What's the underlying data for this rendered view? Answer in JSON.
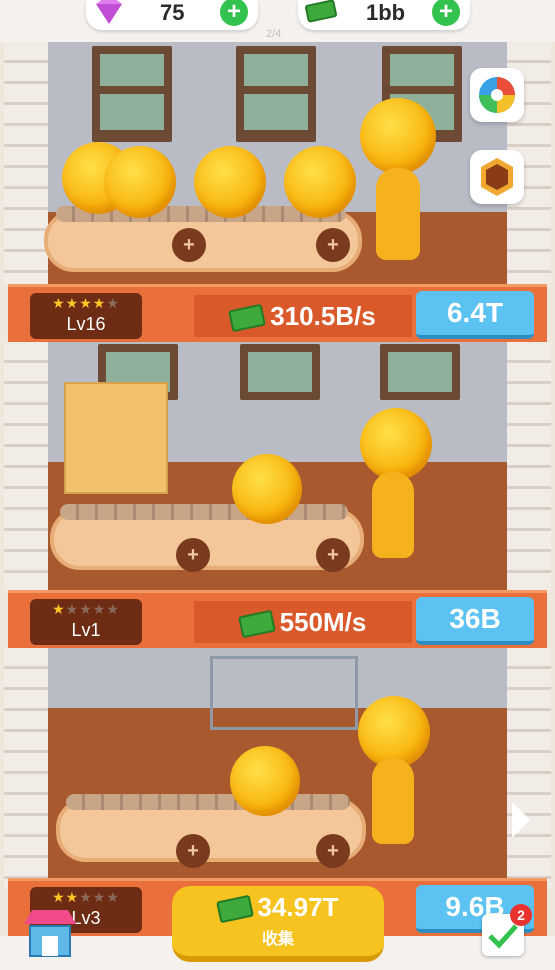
{
  "top": {
    "gems": "75",
    "cash": "1bb",
    "page_indicator": "2/4"
  },
  "floors": [
    {
      "level_label": "Lv16",
      "stars_filled": 4,
      "stars_total": 5,
      "rate": "310.5B/s",
      "upgrade_cost": "6.4T"
    },
    {
      "level_label": "Lv1",
      "stars_filled": 1,
      "stars_total": 5,
      "rate": "550M/s",
      "upgrade_cost": "36B"
    },
    {
      "level_label": "Lv3",
      "stars_filled": 2,
      "stars_total": 5,
      "rate": "",
      "upgrade_cost": "9.6B"
    }
  ],
  "collect": {
    "amount": "34.97T",
    "label": "收集"
  },
  "tasks_badge": "2",
  "icons": [
    "gem-icon",
    "cash-icon",
    "plus-icon",
    "color-wheel-icon",
    "hexagon-icon",
    "shop-icon",
    "checklist-icon",
    "arrow-right-icon"
  ],
  "colors": {
    "accent_orange": "#e9703a",
    "upgrade_blue": "#5cc2f2",
    "collect_yellow": "#f7c320",
    "plus_green": "#33c24d"
  }
}
